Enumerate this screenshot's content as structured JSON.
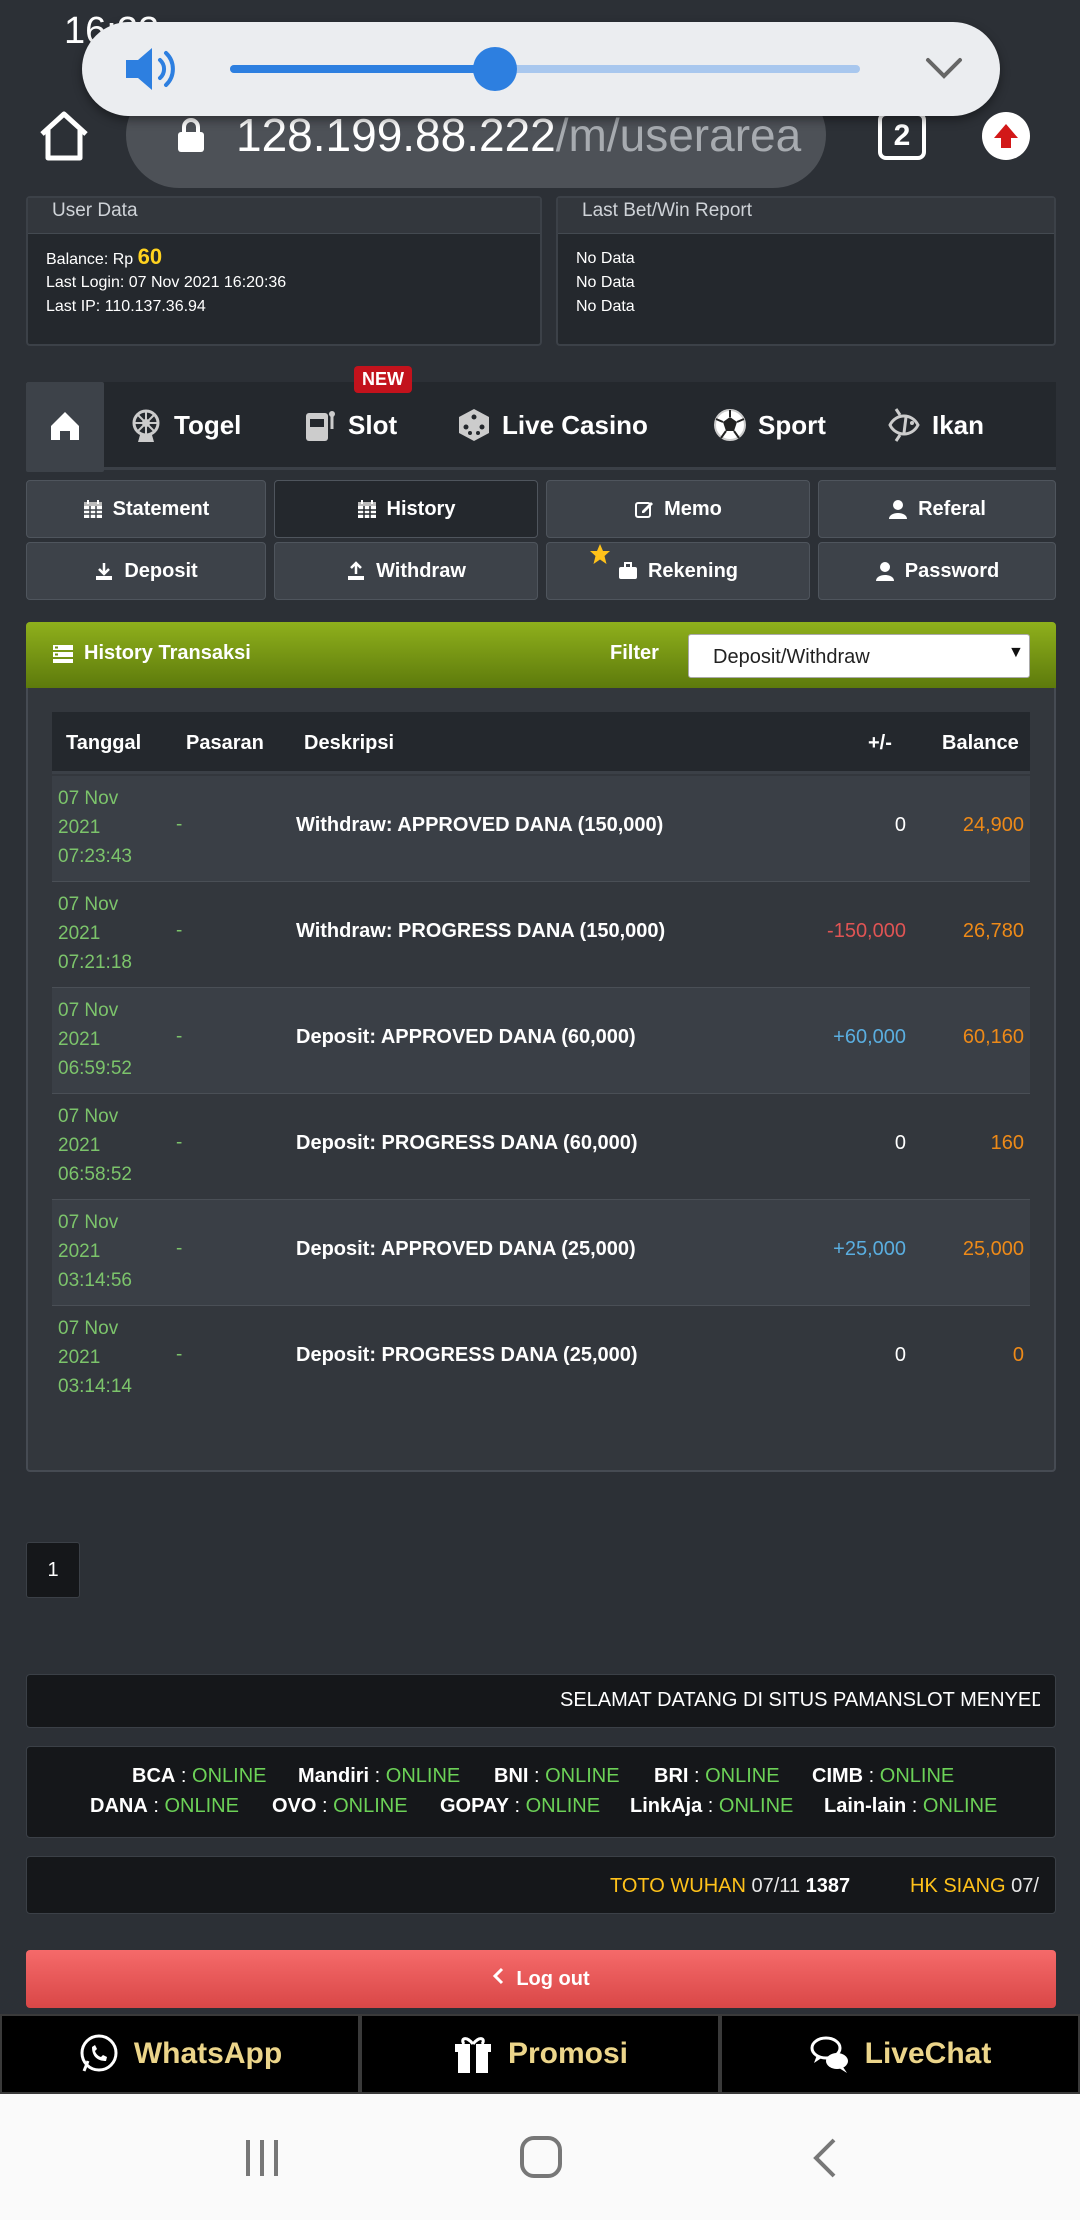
{
  "status_bar": {
    "time": "16:22"
  },
  "browser": {
    "url_host": "128.199.88.222",
    "url_path": "/m/userarea",
    "tab_count": "2"
  },
  "volume": {
    "level": 0.42
  },
  "user_data": {
    "heading": "User Data",
    "balance_label": "Balance: Rp",
    "balance_value": "60",
    "last_login": "Last Login: 07 Nov 2021 16:20:36",
    "last_ip": "Last IP: 110.137.36.94"
  },
  "last_bet": {
    "heading": "Last Bet/Win Report",
    "rows": [
      "No Data",
      "No Data",
      "No Data"
    ]
  },
  "game_nav": {
    "items": [
      {
        "label": "Togel",
        "icon": "wheel-icon"
      },
      {
        "label": "Slot",
        "icon": "slot-machine-icon",
        "badge": "NEW"
      },
      {
        "label": "Live Casino",
        "icon": "dice-icon"
      },
      {
        "label": "Sport",
        "icon": "soccer-ball-icon"
      },
      {
        "label": "Ikan",
        "icon": "fish-icon"
      }
    ]
  },
  "menu": {
    "statement": "Statement",
    "history": "History",
    "memo": "Memo",
    "referal": "Referal",
    "deposit": "Deposit",
    "withdraw": "Withdraw",
    "rekening": "Rekening",
    "password": "Password"
  },
  "history": {
    "title": "History Transaksi",
    "filter_label": "Filter",
    "filter_value": "Deposit/Withdraw",
    "columns": [
      "Tanggal",
      "Pasaran",
      "Deskripsi",
      "+/-",
      "Balance"
    ],
    "rows": [
      {
        "date": "07 Nov 2021 07:23:43",
        "pasaran": "-",
        "desc": "Withdraw: APPROVED DANA (150,000)",
        "amount": "0",
        "amount_type": "zero",
        "balance": "24,900"
      },
      {
        "date": "07 Nov 2021 07:21:18",
        "pasaran": "-",
        "desc": "Withdraw: PROGRESS DANA (150,000)",
        "amount": "-150,000",
        "amount_type": "neg",
        "balance": "26,780"
      },
      {
        "date": "07 Nov 2021 06:59:52",
        "pasaran": "-",
        "desc": "Deposit: APPROVED DANA (60,000)",
        "amount": "+60,000",
        "amount_type": "pos",
        "balance": "60,160"
      },
      {
        "date": "07 Nov 2021 06:58:52",
        "pasaran": "-",
        "desc": "Deposit: PROGRESS DANA (60,000)",
        "amount": "0",
        "amount_type": "zero",
        "balance": "160"
      },
      {
        "date": "07 Nov 2021 03:14:56",
        "pasaran": "-",
        "desc": "Deposit: APPROVED DANA (25,000)",
        "amount": "+25,000",
        "amount_type": "pos",
        "balance": "25,000"
      },
      {
        "date": "07 Nov 2021 03:14:14",
        "pasaran": "-",
        "desc": "Deposit: PROGRESS DANA (25,000)",
        "amount": "0",
        "amount_type": "zero",
        "balance": "0"
      }
    ]
  },
  "pagination": {
    "current": "1"
  },
  "marquee": {
    "text": "SELAMAT DATANG DI SITUS PAMANSLOT MENYEDIA"
  },
  "banks": [
    {
      "name": "BCA",
      "status": "ONLINE"
    },
    {
      "name": "Mandiri",
      "status": "ONLINE"
    },
    {
      "name": "BNI",
      "status": "ONLINE"
    },
    {
      "name": "BRI",
      "status": "ONLINE"
    },
    {
      "name": "CIMB",
      "status": "ONLINE"
    },
    {
      "name": "DANA",
      "status": "ONLINE"
    },
    {
      "name": "OVO",
      "status": "ONLINE"
    },
    {
      "name": "GOPAY",
      "status": "ONLINE"
    },
    {
      "name": "LinkAja",
      "status": "ONLINE"
    },
    {
      "name": "Lain-lain",
      "status": "ONLINE"
    }
  ],
  "results": [
    {
      "name": "TOTO WUHAN",
      "date": "07/11",
      "number": "1387"
    },
    {
      "name": "HK SIANG",
      "date": "07/",
      "number": ""
    }
  ],
  "logout": {
    "label": "Log out"
  },
  "contact": {
    "whatsapp": "WhatsApp",
    "promosi": "Promosi",
    "livechat": "LiveChat"
  },
  "colors": {
    "accent_green": "#8fb01c",
    "date_green": "#7cc46b",
    "balance_orange": "#ee8a18",
    "negative_red": "#e05454",
    "positive_blue": "#5aaee0",
    "logout_red": "#e85a5a",
    "contact_gold": "#ecd58a"
  }
}
